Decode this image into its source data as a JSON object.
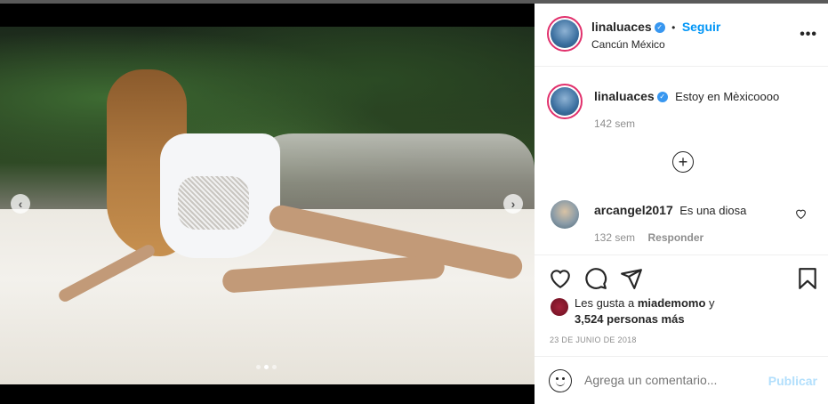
{
  "post": {
    "username": "linaluaces",
    "follow_label": "Seguir",
    "separator": "•",
    "location": "Cancún México",
    "more_label": "•••"
  },
  "caption": {
    "username": "linaluaces",
    "text": "Estoy en Mèxicoooo",
    "time": "142 sem"
  },
  "load_more": "+",
  "comments": [
    {
      "username": "arcangel2017",
      "text": "Es una diosa",
      "time": "132 sem",
      "reply_label": "Responder"
    }
  ],
  "likes": {
    "line1_prefix": "Les gusta a",
    "liker": "miademomo",
    "line1_suffix": "y",
    "line2": "3,524 personas más"
  },
  "date": "23 DE JUNIO DE 2018",
  "add_comment": {
    "placeholder": "Agrega un comentario...",
    "publish_label": "Publicar"
  },
  "carousel": {
    "prev_icon": "‹",
    "next_icon": "›",
    "slide_count": 3,
    "active_index": 1
  },
  "colors": {
    "accent": "#0095f6",
    "verified": "#3897f0",
    "publish_disabled": "#b2dffc"
  }
}
